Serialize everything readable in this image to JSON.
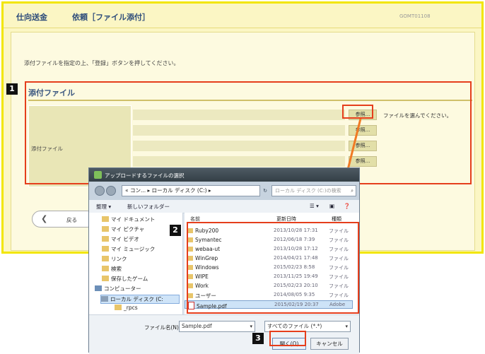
{
  "app": {
    "brand": "仕向送金",
    "title": "依頼［ファイル添付］",
    "screen_id": "GOMT01108",
    "instruction": "添付ファイルを指定の上、「登録」ボタンを押してください。",
    "section_title": "添付ファイル",
    "row_label": "添付ファイル",
    "browse_label": "参照...",
    "browse_hint": "ファイルを選んでください。",
    "back_label": "戻る"
  },
  "steps": [
    "1",
    "2",
    "3"
  ],
  "dialog": {
    "title": "アップロードするファイルの選択",
    "address": "« コン... ▸ ローカル ディスク (C:) ▸",
    "search_placeholder": "ローカル ディスク (C:)の検索",
    "toolbar": {
      "organize": "整理 ▾",
      "new_folder": "新しいフォルダー"
    },
    "nav_items": [
      "マイ ドキュメント",
      "マイ ピクチャ",
      "マイ ビデオ",
      "マイ ミュージック",
      "リンク",
      "検索",
      "保存したゲーム",
      "コンピューター",
      "ローカル ディスク (C:",
      "_rpcs"
    ],
    "columns": {
      "name": "名前",
      "date": "更新日時",
      "type": "種類"
    },
    "files": [
      {
        "name": "Ruby200",
        "date": "2013/10/28 17:31",
        "type": "ファイル"
      },
      {
        "name": "Symantec",
        "date": "2012/06/18 7:39",
        "type": "ファイル"
      },
      {
        "name": "webaa-ut",
        "date": "2013/10/28 17:12",
        "type": "ファイル"
      },
      {
        "name": "WinGrep",
        "date": "2014/04/21 17:48",
        "type": "ファイル"
      },
      {
        "name": "Windows",
        "date": "2015/02/23 8:58",
        "type": "ファイル"
      },
      {
        "name": "WIPE",
        "date": "2013/11/25 19:49",
        "type": "ファイル"
      },
      {
        "name": "Work",
        "date": "2015/02/23 20:10",
        "type": "ファイル"
      },
      {
        "name": "ユーザー",
        "date": "2014/08/05 9:35",
        "type": "ファイル"
      },
      {
        "name": "Sample.pdf",
        "date": "2015/02/19 20:37",
        "type": "Adobe"
      }
    ],
    "filename_label": "ファイル名(N):",
    "filename_value": "Sample.pdf",
    "filetype_value": "すべてのファイル (*.*)",
    "open_label": "開く(O)",
    "cancel_label": "キャンセル"
  },
  "colors": {
    "highlight": "#e53e1c",
    "arrow": "#f07a24",
    "page_bg": "#fbf6c4"
  }
}
